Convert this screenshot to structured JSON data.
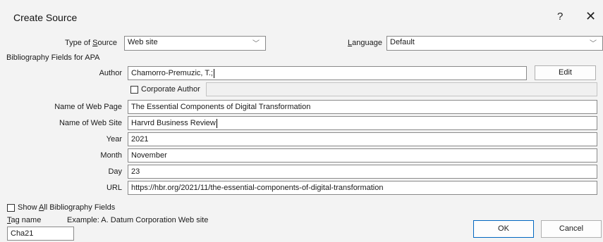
{
  "dialog": {
    "title": "Create Source",
    "help_label": "?",
    "close_label": "✕"
  },
  "type_of_source": {
    "label_pre": "Type of ",
    "label_key": "S",
    "label_post": "ource",
    "value": "Web site"
  },
  "language": {
    "label_key": "L",
    "label_post": "anguage",
    "value": "Default"
  },
  "group_label": "Bibliography Fields for APA",
  "author": {
    "label": "Author",
    "value": "Chamorro-Premuzic, T.;",
    "edit_label": "Edit",
    "corporate_label": "Corporate Author"
  },
  "fields": {
    "web_page": {
      "label": "Name of Web Page",
      "value": "The Essential Components of Digital Transformation"
    },
    "web_site": {
      "label": "Name of Web Site",
      "value": "Harvrd Business Review"
    },
    "year": {
      "label": "Year",
      "value": "2021"
    },
    "month": {
      "label": "Month",
      "value": "November"
    },
    "day": {
      "label": "Day",
      "value": "23"
    },
    "url": {
      "label": "URL",
      "value": "https://hbr.org/2021/11/the-essential-components-of-digital-transformation"
    }
  },
  "show_all": {
    "label_pre": "Show ",
    "label_key": "A",
    "label_post": "ll Bibliography Fields"
  },
  "tag": {
    "label_key": "T",
    "label_post": "ag name",
    "value": "Cha21"
  },
  "example": "Example: A. Datum Corporation Web site",
  "buttons": {
    "ok": "OK",
    "cancel": "Cancel"
  },
  "colors": {
    "panel_bg": "#f3f3f3",
    "primary_border": "#0067c0"
  }
}
